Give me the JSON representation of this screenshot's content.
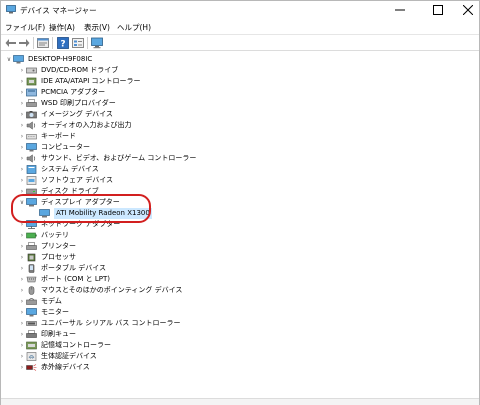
{
  "window": {
    "title": "デバイス マネージャー"
  },
  "menu": [
    {
      "label": "ファイル(F)"
    },
    {
      "label": "操作(A)"
    },
    {
      "label": "表示(V)"
    },
    {
      "label": "ヘルプ(H)"
    }
  ],
  "tree": {
    "root": "DESKTOP-H9F08IC",
    "categories": [
      {
        "label": "DVD/CD-ROM ドライブ",
        "icon": "dvd-drive-icon"
      },
      {
        "label": "IDE ATA/ATAPI コントローラー",
        "icon": "ide-controller-icon"
      },
      {
        "label": "PCMCIA アダプター",
        "icon": "pcmcia-icon"
      },
      {
        "label": "WSD 印刷プロバイダー",
        "icon": "printer-icon"
      },
      {
        "label": "イメージング デバイス",
        "icon": "camera-icon"
      },
      {
        "label": "オーディオの入力および出力",
        "icon": "speaker-icon"
      },
      {
        "label": "キーボード",
        "icon": "keyboard-icon"
      },
      {
        "label": "コンピューター",
        "icon": "computer-icon"
      },
      {
        "label": "サウンド、ビデオ、およびゲーム コントローラー",
        "icon": "speaker-icon"
      },
      {
        "label": "システム デバイス",
        "icon": "system-device-icon"
      },
      {
        "label": "ソフトウェア デバイス",
        "icon": "software-device-icon"
      },
      {
        "label": "ディスク ドライブ",
        "icon": "disk-drive-icon"
      },
      {
        "label": "ディスプレイ アダプター",
        "icon": "display-adapter-icon",
        "expanded": true,
        "children": [
          "ATI Mobility Radeon X1300"
        ]
      },
      {
        "label": "ネットワーク アダプター",
        "icon": "network-adapter-icon"
      },
      {
        "label": "バッテリ",
        "icon": "battery-icon"
      },
      {
        "label": "プリンター",
        "icon": "printer-icon"
      },
      {
        "label": "プロセッサ",
        "icon": "processor-icon"
      },
      {
        "label": "ポータブル デバイス",
        "icon": "portable-device-icon"
      },
      {
        "label": "ポート (COM と LPT)",
        "icon": "port-icon"
      },
      {
        "label": "マウスとそのほかのポインティング デバイス",
        "icon": "mouse-icon"
      },
      {
        "label": "モデム",
        "icon": "modem-icon"
      },
      {
        "label": "モニター",
        "icon": "monitor-icon"
      },
      {
        "label": "ユニバーサル シリアル バス コントローラー",
        "icon": "usb-icon"
      },
      {
        "label": "印刷キュー",
        "icon": "print-queue-icon"
      },
      {
        "label": "記憶域コントローラー",
        "icon": "storage-controller-icon"
      },
      {
        "label": "生体認証デバイス",
        "icon": "biometric-icon"
      },
      {
        "label": "赤外線デバイス",
        "icon": "infrared-icon"
      }
    ]
  },
  "colors": {
    "annotation": "#d21f1f",
    "selection": "#cce8ff"
  }
}
